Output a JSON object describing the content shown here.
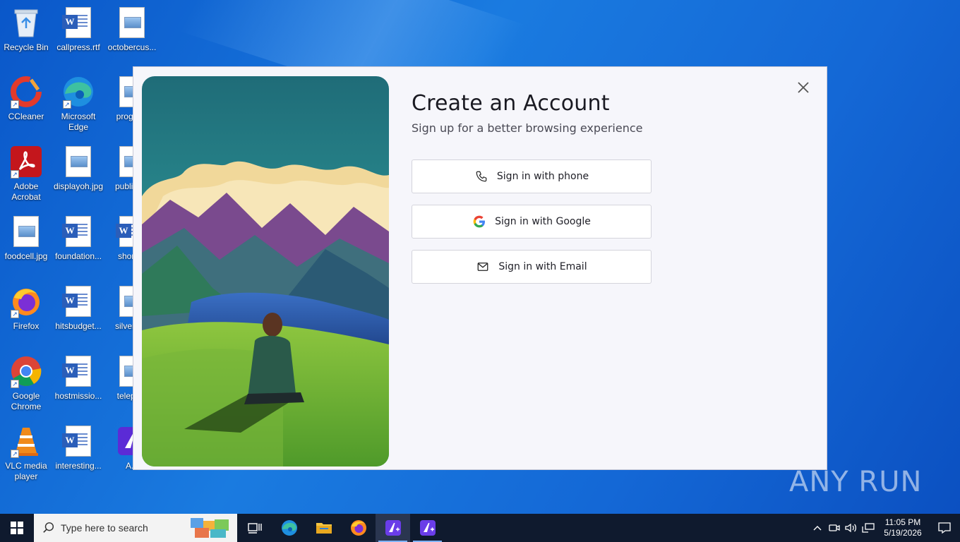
{
  "desktop": {
    "icons": [
      {
        "label": "Recycle Bin",
        "icon": "recycle-bin-icon"
      },
      {
        "label": "callpress.rtf",
        "icon": "word-document-icon"
      },
      {
        "label": "octobercus...",
        "icon": "image-file-icon"
      },
      {
        "label": "CCleaner",
        "icon": "ccleaner-icon"
      },
      {
        "label": "Microsoft Edge",
        "icon": "edge-icon"
      },
      {
        "label": "progra...",
        "icon": "image-file-icon"
      },
      {
        "label": "Adobe Acrobat",
        "icon": "acrobat-icon"
      },
      {
        "label": "displayoh.jpg",
        "icon": "image-file-icon"
      },
      {
        "label": "publica...",
        "icon": "image-file-icon"
      },
      {
        "label": "foodcell.jpg",
        "icon": "image-file-icon"
      },
      {
        "label": "foundation...",
        "icon": "word-document-icon"
      },
      {
        "label": "shortr...",
        "icon": "word-document-icon"
      },
      {
        "label": "Firefox",
        "icon": "firefox-icon"
      },
      {
        "label": "hitsbudget...",
        "icon": "word-document-icon"
      },
      {
        "label": "silverm...",
        "icon": "image-file-icon"
      },
      {
        "label": "Google Chrome",
        "icon": "chrome-icon"
      },
      {
        "label": "hostmissio...",
        "icon": "word-document-icon"
      },
      {
        "label": "teleph...",
        "icon": "image-file-icon"
      },
      {
        "label": "VLC media player",
        "icon": "vlc-icon"
      },
      {
        "label": "interesting...",
        "icon": "word-document-icon"
      },
      {
        "label": "A...",
        "icon": "app-icon"
      }
    ]
  },
  "modal": {
    "title": "Create an Account",
    "subtitle": "Sign up for a better browsing experience",
    "buttons": {
      "phone": "Sign in with phone",
      "google": "Sign in with Google",
      "email": "Sign in with Email"
    },
    "close_icon": "close-icon",
    "art_icon": "illustration-person-mountain-lake"
  },
  "watermark": {
    "text": "ANY RUN"
  },
  "taskbar": {
    "search_placeholder": "Type here to search",
    "apps": [
      "task-view-icon",
      "edge-icon",
      "file-explorer-icon",
      "firefox-icon",
      "app-icon",
      "app-icon"
    ],
    "clock": {
      "time": "11:05 PM",
      "date": "5/19/2026"
    }
  },
  "colors": {
    "desktop_bg": "#1468d6",
    "taskbar_bg": "#0f1a2e",
    "modal_bg": "#f6f6fb",
    "accent_app": "#6a3de8"
  }
}
